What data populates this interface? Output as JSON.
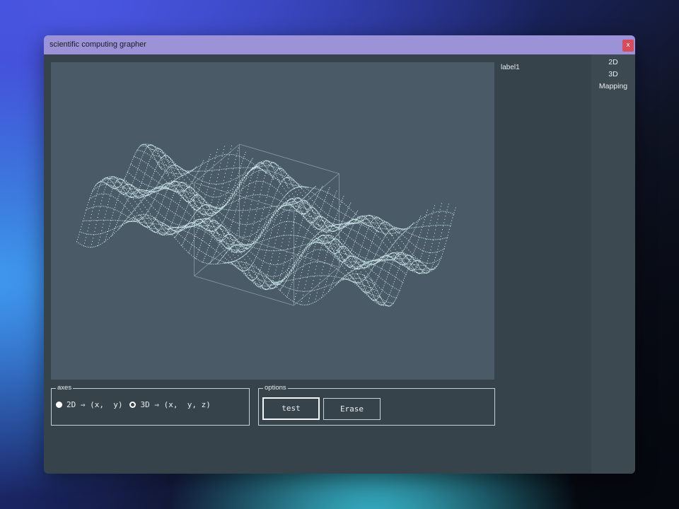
{
  "window": {
    "title": "scientific computing grapher",
    "close_label": "x"
  },
  "canvas": {
    "plot": "3d-surface",
    "style": "dotted-mesh",
    "dot_color": "#d6f2f6",
    "background": "#4a5b67"
  },
  "status": {
    "label": "label1"
  },
  "menu": {
    "items": [
      "2D",
      "3D",
      "Mapping"
    ]
  },
  "axes": {
    "legend": "axes",
    "options": [
      {
        "label": "2D ⇒ (x,  y)",
        "selected": true
      },
      {
        "label": "3D ⇒ (x,  y, z)",
        "selected": false
      }
    ]
  },
  "options": {
    "legend": "options",
    "test_label": "test",
    "erase_label": "Erase"
  },
  "colors": {
    "titlebar": "#9b92d8",
    "window": "#37434b",
    "close": "#d94a5a"
  }
}
